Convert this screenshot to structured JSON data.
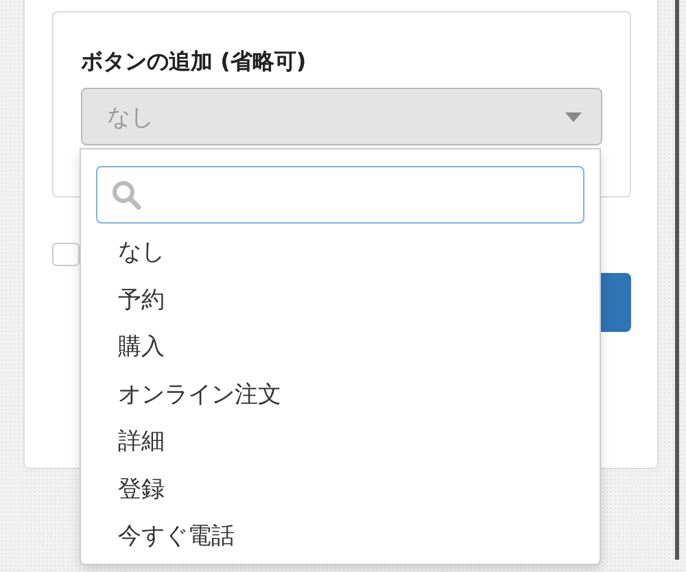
{
  "section": {
    "label": "ボタンの追加 (省略可)",
    "select": {
      "value": "なし",
      "disabled": true
    }
  },
  "checkbox": {
    "checked": false
  },
  "dropdown": {
    "options": [
      {
        "label": "なし",
        "selected": false
      },
      {
        "label": "予約",
        "selected": false
      },
      {
        "label": "購入",
        "selected": false
      },
      {
        "label": "オンライン注文",
        "selected": false
      },
      {
        "label": "詳細",
        "selected": false
      },
      {
        "label": "登録",
        "selected": false
      },
      {
        "label": "今すぐ電話",
        "selected": false
      }
    ]
  }
}
